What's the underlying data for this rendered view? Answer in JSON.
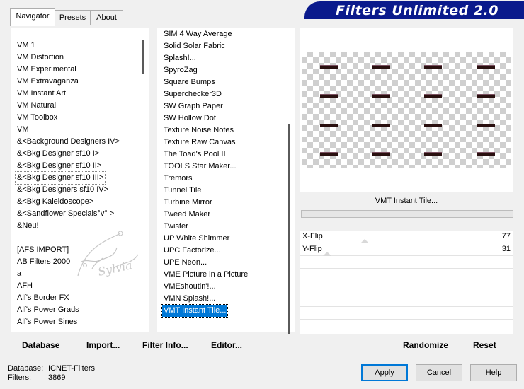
{
  "tabs": [
    "Navigator",
    "Presets",
    "About"
  ],
  "banner": "Filters Unlimited 2.0",
  "categories": [
    "VM 1",
    "VM Distortion",
    "VM Experimental",
    "VM Extravaganza",
    "VM Instant Art",
    "VM Natural",
    "VM Toolbox",
    "VM",
    "&<Background Designers IV>",
    "&<Bkg Designer sf10 I>",
    "&<Bkg Designer sf10 II>",
    "&<Bkg Designer sf10 III>",
    "&<Bkg Designers sf10 IV>",
    "&<Bkg Kaleidoscope>",
    "&<Sandflower Specials°v° >",
    "&Neu!",
    "",
    "[AFS IMPORT]",
    "AB Filters 2000",
    "a",
    "AFH",
    "Alf's Border FX",
    "Alf's Power Grads",
    "Alf's Power Sines"
  ],
  "filters": [
    "SIM 4 Way Average",
    "Solid Solar Fabric",
    "Splash!...",
    "SpyroZag",
    "Square Bumps",
    "Superchecker3D",
    "SW Graph Paper",
    "SW Hollow Dot",
    "Texture Noise Notes",
    "Texture Raw Canvas",
    "The Toad's Pool II",
    "TOOLS Star Maker...",
    "Tremors",
    "Tunnel Tile",
    "Turbine Mirror",
    "Tweed Maker",
    "Twister",
    "UP White Shimmer",
    "UPC Factorize...",
    "UPE Neon...",
    "VME Picture in a Picture",
    "VMEshoutin'!...",
    "VMN Splash!...",
    "VMT Instant Tile..."
  ],
  "selected_filter": "VMT Instant Tile...",
  "params": [
    {
      "label": "X-Flip",
      "value": "77"
    },
    {
      "label": "Y-Flip",
      "value": "31"
    }
  ],
  "left_buttons": [
    "Database",
    "Import...",
    "Filter Info...",
    "Editor..."
  ],
  "right_buttons": [
    "Randomize",
    "Reset"
  ],
  "status": {
    "database_label": "Database:",
    "database_value": "ICNET-Filters",
    "filters_label": "Filters:",
    "filters_value": "3869"
  },
  "dialog_buttons": {
    "apply": "Apply",
    "cancel": "Cancel",
    "help": "Help"
  },
  "watermark_text": "Sylvia"
}
